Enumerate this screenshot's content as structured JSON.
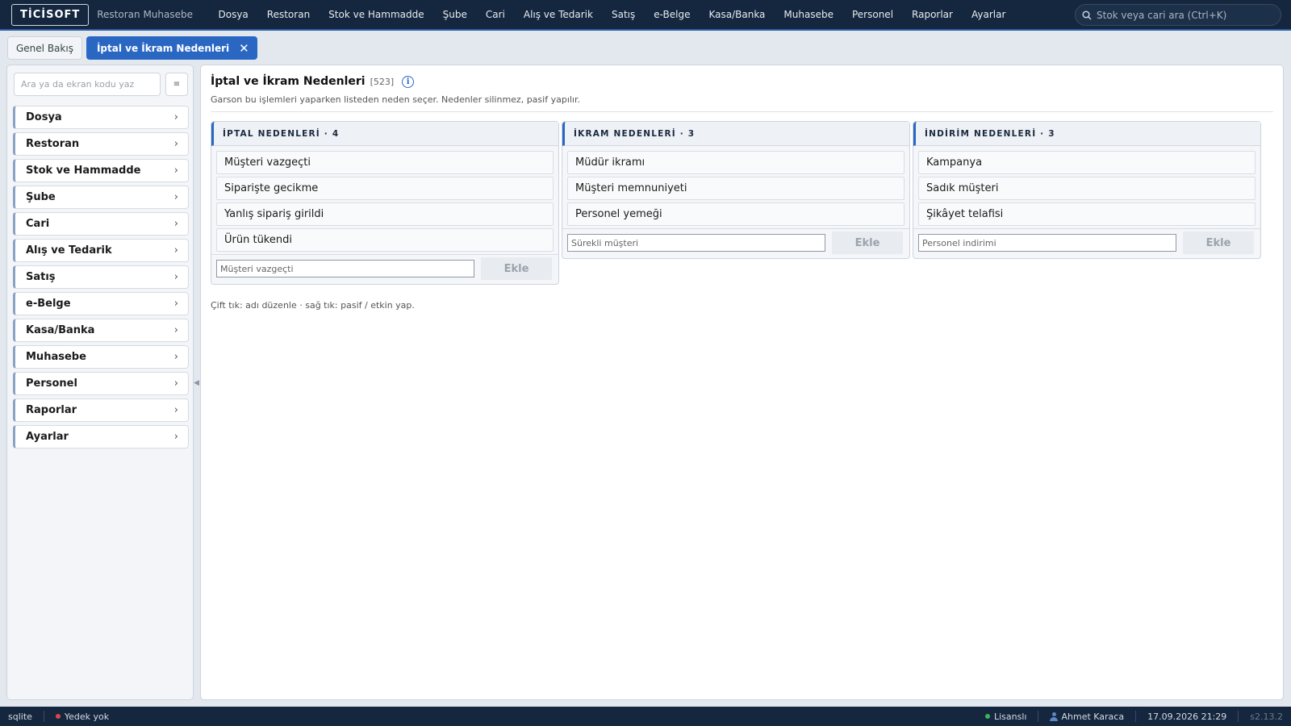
{
  "app": {
    "logo": "TİCİSOFT",
    "name": "Restoran Muhasebe"
  },
  "menu": [
    "Dosya",
    "Restoran",
    "Stok ve Hammadde",
    "Şube",
    "Cari",
    "Alış ve Tedarik",
    "Satış",
    "e-Belge",
    "Kasa/Banka",
    "Muhasebe",
    "Personel",
    "Raporlar",
    "Ayarlar"
  ],
  "search": {
    "placeholder": "Stok veya cari ara (Ctrl+K)"
  },
  "tabs": [
    {
      "label": "Genel Bakış",
      "active": false
    },
    {
      "label": "İptal ve İkram Nedenleri",
      "active": true,
      "close": "✕"
    }
  ],
  "sidebar": {
    "search_placeholder": "Ara ya da ekran kodu yaz",
    "grid_icon": "≡",
    "items": [
      "Dosya",
      "Restoran",
      "Stok ve Hammadde",
      "Şube",
      "Cari",
      "Alış ve Tedarik",
      "Satış",
      "e-Belge",
      "Kasa/Banka",
      "Muhasebe",
      "Personel",
      "Raporlar",
      "Ayarlar"
    ]
  },
  "page": {
    "title": "İptal ve İkram Nedenleri",
    "code": "[523]",
    "subtitle": "Garson bu işlemleri yaparken listeden neden seçer. Nedenler silinmez, pasif yapılır.",
    "hint": "Çift tık: adı düzenle · sağ tık: pasif / etkin yap."
  },
  "panels": [
    {
      "title": "İPTAL NEDENLERİ · 4",
      "items": [
        "Müşteri vazgeçti",
        "Siparişte gecikme",
        "Yanlış sipariş girildi",
        "Ürün tükendi"
      ],
      "input_placeholder": "Müşteri vazgeçti",
      "button": "Ekle"
    },
    {
      "title": "İKRAM NEDENLERİ · 3",
      "items": [
        "Müdür ikramı",
        "Müşteri memnuniyeti",
        "Personel yemeği"
      ],
      "input_placeholder": "Sürekli müşteri",
      "button": "Ekle"
    },
    {
      "title": "İNDİRİM NEDENLERİ · 3",
      "items": [
        "Kampanya",
        "Sadık müşteri",
        "Şikâyet telafisi"
      ],
      "input_placeholder": "Personel indirimi",
      "button": "Ekle"
    }
  ],
  "status": {
    "db": "sqlite",
    "backup": "Yedek yok",
    "license": "Lisanslı",
    "user": "Ahmet Karaca",
    "datetime": "17.09.2026 21:29",
    "version": "s2.13.2"
  },
  "colors": {
    "topbar": "#15273f",
    "accent": "#2a67c3",
    "backup_dot": "#e04646",
    "license_dot": "#3cb55a"
  }
}
